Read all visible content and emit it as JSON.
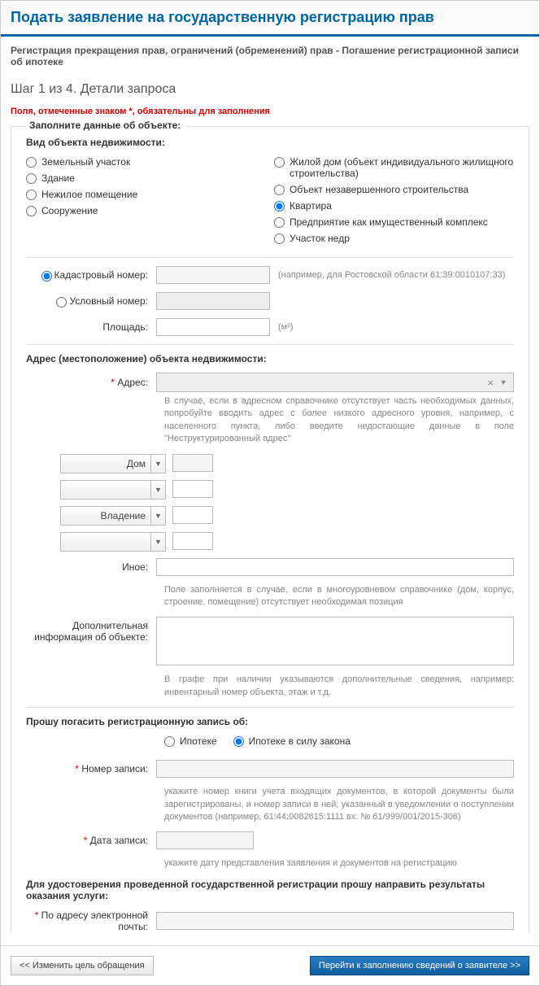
{
  "header": {
    "title": "Подать заявление на государственную регистрацию прав"
  },
  "subheader": "Регистрация прекращения прав, ограничений (обременений) прав - Погашение регистрационной записи об ипотеке",
  "step": "Шаг 1 из 4. Детали запроса",
  "required_note": "Поля, отмеченные знаком *, обязательны для заполнения",
  "section1": {
    "legend": "Заполните данные об объекте:",
    "type_label": "Вид объекта недвижимости:",
    "types_left": [
      "Земельный участок",
      "Здание",
      "Нежилое помещение",
      "Сооружение"
    ],
    "types_right": [
      "Жилой дом (объект индивидуального жилищного строительства)",
      "Объект незавершенного строительства",
      "Квартира",
      "Предприятие как имущественный комплекс",
      "Участок недр"
    ],
    "selected_type": "Квартира",
    "cadastral_label": "Кадастровый номер:",
    "cadastral_hint": "(например, для Ростовской области 61:39:0010107:33)",
    "conditional_label": "Условный номер:",
    "area_label": "Площадь:",
    "area_unit": "(м²)"
  },
  "address": {
    "heading": "Адрес (местоположение) объекта недвижимости:",
    "label": "Адрес:",
    "hint": "В случае, если в адресном справочнике отсутствует часть необходимых данных, попробуйте вводить адрес с более низкого адресного уровня, например, с населенного пункта, либо введите недостающие данные в поле \"Неструктурированный адрес\"",
    "combo1": "Дом",
    "combo2": "",
    "combo3": "Владение",
    "combo4": "",
    "other_label": "Иное:",
    "other_hint": "Поле заполняется в случае, если в многоуровневом справочнике (дом, корпус, строение, помещение) отсутствует необходимая позиция",
    "extra_label": "Дополнительная информация об объекте:",
    "extra_hint": "В графе при наличии указываются дополнительные сведения, например: инвентарный номер объекта, этаж и т.д."
  },
  "record": {
    "heading": "Прошу погасить регистрационную запись об:",
    "opt1": "Ипотеке",
    "opt2": "Ипотеке в силу закона",
    "number_label": "Номер записи:",
    "number_hint": "укажите номер книги учета входящих документов, в которой документы были зарегистрированы, и номер записи в ней, указанный в уведомлении о поступлении документов (например, 61:44:0082615:1111 вх. № 61/999/001/2015-306)",
    "date_label": "Дата записи:",
    "date_hint": "укажите дату представления заявления и документов на регистрацию"
  },
  "delivery": {
    "heading": "Для удостоверения проведенной государственной регистрации прошу направить результаты оказания услуги:",
    "email_label": "По адресу электронной почты:"
  },
  "footer": {
    "back": "<< Изменить цель обращения",
    "next": "Перейти к заполнению сведений о заявителе >>"
  }
}
